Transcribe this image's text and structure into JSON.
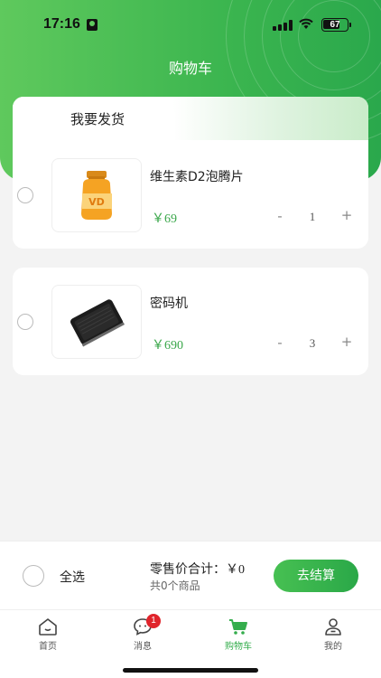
{
  "status_bar": {
    "time": "17:16",
    "battery": "67"
  },
  "header": {
    "title": "购物车"
  },
  "tabs": {
    "active_label": "我要发货"
  },
  "items": [
    {
      "name": "维生素D2泡腾片",
      "price": "￥69",
      "qty": "1",
      "minus": "-",
      "plus": "+",
      "image": "orange-bottle"
    },
    {
      "name": "密码机",
      "price": "￥690",
      "qty": "3",
      "minus": "-",
      "plus": "+",
      "image": "black-device"
    }
  ],
  "checkout": {
    "select_all": "全选",
    "total_label": "零售价合计：",
    "total_value": "￥0",
    "count_text": "共0个商品",
    "button": "去结算"
  },
  "tabbar": {
    "items": [
      {
        "label": "首页",
        "icon": "home-icon"
      },
      {
        "label": "消息",
        "icon": "message-icon",
        "badge": "1"
      },
      {
        "label": "购物车",
        "icon": "cart-icon",
        "active": true
      },
      {
        "label": "我的",
        "icon": "profile-icon"
      }
    ]
  },
  "colors": {
    "accent": "#3bb54f",
    "price": "#3aa74a",
    "badge": "#e0242b"
  }
}
